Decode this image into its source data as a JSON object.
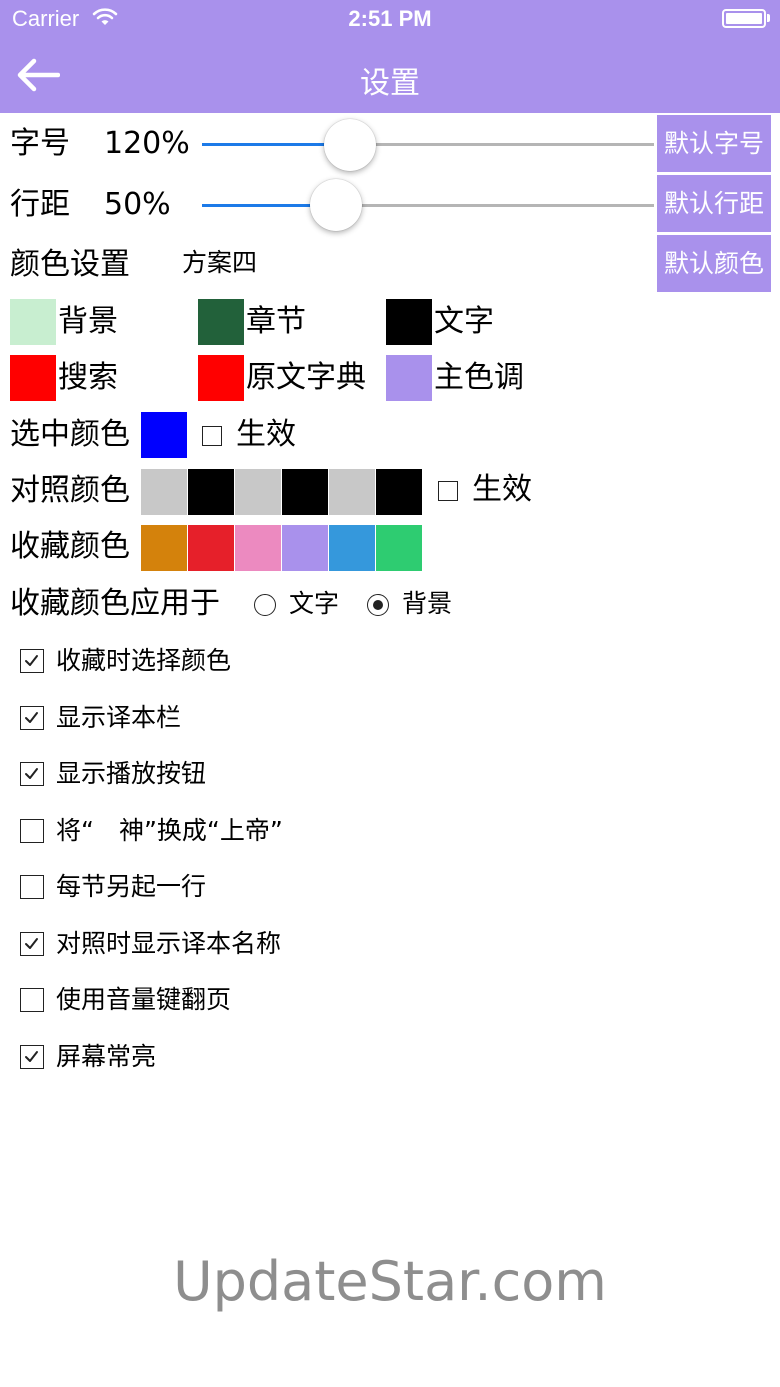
{
  "status_bar": {
    "carrier": "Carrier",
    "time": "2:51 PM"
  },
  "header": {
    "title": "设置",
    "background": "#a991ec",
    "back_icon": "arrow-left-icon"
  },
  "font_size": {
    "label": "字号",
    "value_text": "120%",
    "slider_fraction": 0.3,
    "reset_button": "默认字号"
  },
  "line_spacing": {
    "label": "行距",
    "value_text": "50%",
    "slider_fraction": 0.27,
    "reset_button": "默认行距"
  },
  "color_settings": {
    "label": "颜色设置",
    "scheme": "方案四",
    "reset_button": "默认颜色",
    "swatches": [
      {
        "label": "背景",
        "color": "#c8eed0"
      },
      {
        "label": "章节",
        "color": "#22613a"
      },
      {
        "label": "文字",
        "color": "#000000"
      },
      {
        "label": "搜索",
        "color": "#ff0000"
      },
      {
        "label": "原文字典",
        "color": "#ff0000"
      },
      {
        "label": "主色调",
        "color": "#a991ec"
      }
    ]
  },
  "selection_color": {
    "label": "选中颜色",
    "color": "#0000ff",
    "toggle_label": "生效",
    "enabled": false
  },
  "compare_colors": {
    "label": "对照颜色",
    "colors": [
      "#c8c8c8",
      "#000000",
      "#c8c8c8",
      "#000000",
      "#c8c8c8",
      "#000000"
    ],
    "toggle_label": "生效",
    "enabled": false
  },
  "favorite_colors": {
    "label": "收藏颜色",
    "colors": [
      "#d4820c",
      "#e6202a",
      "#ec8ac0",
      "#a991ec",
      "#3598dc",
      "#2ecc71"
    ]
  },
  "favorite_apply": {
    "label": "收藏颜色应用于",
    "options": [
      {
        "label": "文字",
        "selected": false
      },
      {
        "label": "背景",
        "selected": true
      }
    ]
  },
  "options": [
    {
      "label": "收藏时选择颜色",
      "checked": true
    },
    {
      "label": "显示译本栏",
      "checked": true
    },
    {
      "label": "显示播放按钮",
      "checked": true
    },
    {
      "label": "将“　神”换成“上帝”",
      "checked": false
    },
    {
      "label": "每节另起一行",
      "checked": false
    },
    {
      "label": "对照时显示译本名称",
      "checked": true
    },
    {
      "label": "使用音量键翻页",
      "checked": false
    },
    {
      "label": "屏幕常亮",
      "checked": true
    }
  ],
  "watermark": "UpdateStar.com"
}
